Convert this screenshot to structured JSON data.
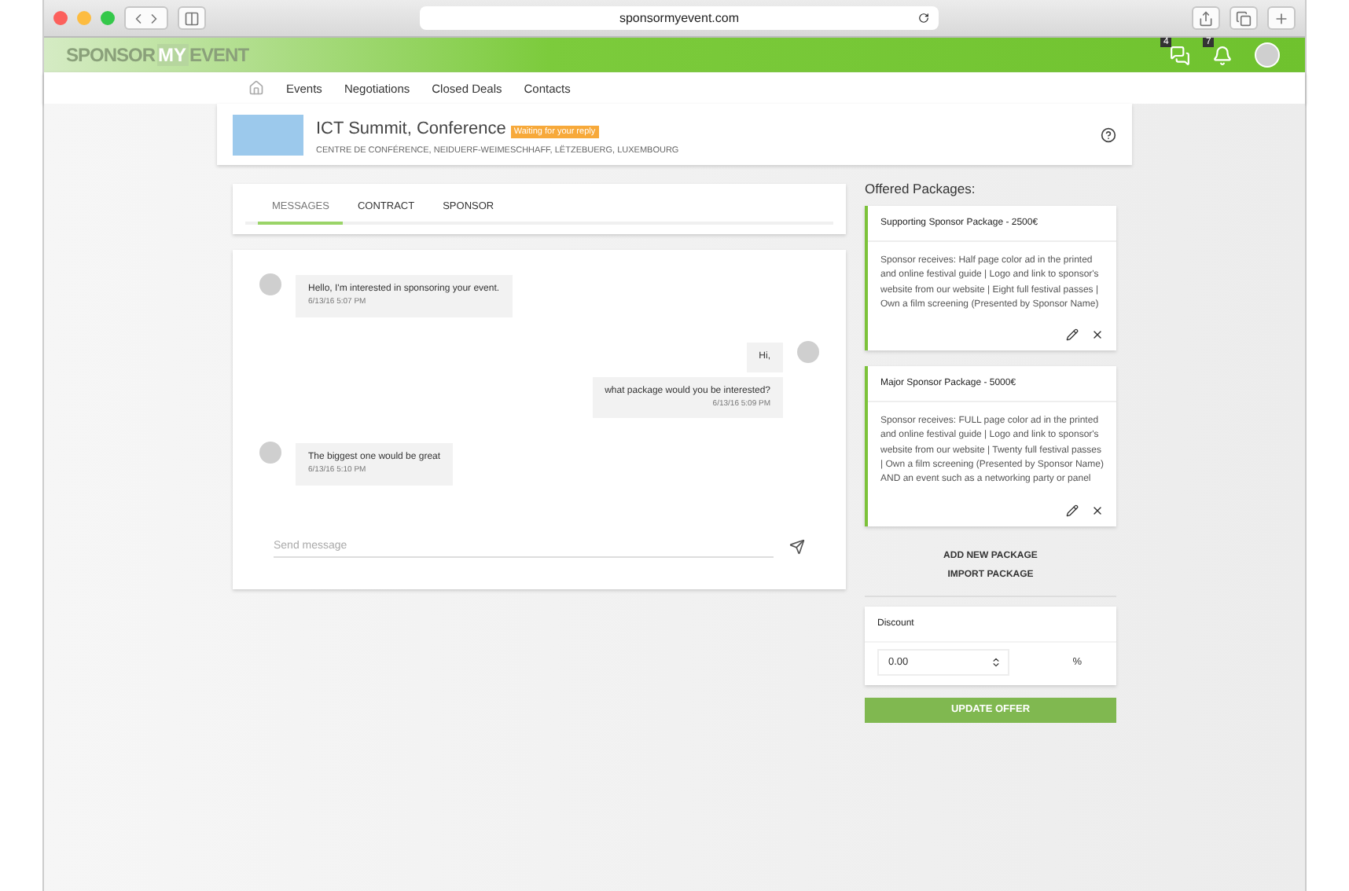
{
  "browser": {
    "url": "sponsormyevent.com"
  },
  "header": {
    "logo_left": "SPONSOR",
    "logo_mid": "MY",
    "logo_right": "EVENT",
    "chat_count": "4",
    "notification_count": "7"
  },
  "nav": [
    {
      "label": "Events",
      "selected": false
    },
    {
      "label": "Negotiations",
      "selected": false
    },
    {
      "label": "Closed Deals",
      "selected": false
    },
    {
      "label": "Contacts",
      "selected": false
    }
  ],
  "event": {
    "title": "ICT Summit, Conference",
    "status": "Waiting for your reply",
    "location": "CENTRE DE CONFÉRENCE, NEIDUERF-WEIMESCHHAFF, LËTZEBUERG, LUXEMBOURG"
  },
  "tabs": [
    {
      "label": "MESSAGES",
      "selected": true
    },
    {
      "label": "CONTRACT",
      "selected": false
    },
    {
      "label": "SPONSOR",
      "selected": false
    }
  ],
  "messages": [
    {
      "kind": "incoming",
      "bubbles": [
        {
          "text": "Hello, I'm interested in sponsoring your event.",
          "time": "6/13/16 5:07 PM"
        }
      ]
    },
    {
      "kind": "outgoing",
      "bubbles": [
        {
          "text": "Hi,"
        },
        {
          "text": "what package would you be interested?",
          "time": "6/13/16 5:09 PM"
        }
      ]
    },
    {
      "kind": "incoming",
      "bubbles": [
        {
          "text": "The biggest one would be great",
          "time": "6/13/16 5:10 PM"
        }
      ]
    }
  ],
  "composer": {
    "placeholder": "Send message"
  },
  "packages_title": "Offered Packages:",
  "packages": [
    {
      "title": "Supporting Sponsor Package - 2500€",
      "description": "Sponsor receives: Half page color ad in the printed and online festival guide | Logo and link to sponsor's website from our website | Eight full festival passes | Own a film screening (Presented by Sponsor Name)"
    },
    {
      "title": "Major Sponsor Package - 5000€",
      "description": "Sponsor receives: FULL page color ad in the printed and online festival guide | Logo and link to sponsor's website from our website | Twenty full festival passes | Own a film screening (Presented by Sponsor Name) AND an event such as a networking party or panel"
    }
  ],
  "package_actions": [
    "ADD NEW PACKAGE",
    "IMPORT PACKAGE"
  ],
  "discount": {
    "label": "Discount",
    "value": "0.00",
    "unit": "%"
  },
  "submit": "UPDATE OFFER"
}
